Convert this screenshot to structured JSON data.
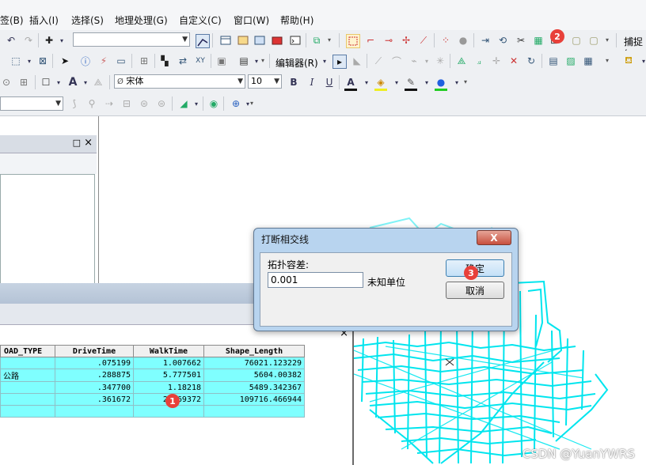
{
  "menu": {
    "items": [
      "签(B)",
      "插入(I)",
      "选择(S)",
      "地理处理(G)",
      "自定义(C)",
      "窗口(W)",
      "帮助(H)"
    ]
  },
  "toolbar1": {
    "snap_label": "捕捉("
  },
  "toolbar2": {
    "editor_label": "编辑器(R)"
  },
  "toolbar3": {
    "font_name": "宋体",
    "font_size": "10",
    "bold": "B",
    "italic": "I",
    "underline": "U"
  },
  "toc": {
    "close_glyph": "×",
    "restore_glyph": "□"
  },
  "attribute_table": {
    "columns": [
      "OAD_TYPE",
      "DriveTime",
      "WalkTime",
      "Shape_Length"
    ],
    "rows": [
      [
        "",
        ".075199",
        "1.007662",
        "76021.123229"
      ],
      [
        "公路",
        ".288875",
        "5.777501",
        "5604.00382"
      ],
      [
        "",
        ".347700",
        "1.18218",
        "5489.342367"
      ],
      [
        "",
        ".361672",
        "2.169372",
        "109716.466944"
      ],
      [
        "",
        "",
        "",
        ""
      ]
    ],
    "close_glyph": "×"
  },
  "dialog": {
    "title": "打断相交线",
    "close_glyph": "X",
    "tolerance_label": "拓扑容差:",
    "tolerance_value": "0.001",
    "unit_label": "未知单位",
    "ok_label": "确定",
    "cancel_label": "取消"
  },
  "badges": {
    "b1": "1",
    "b2": "2",
    "b3": "3"
  },
  "watermark": "CSDN @YuanYWRS",
  "colors": {
    "road": "#00e5ee",
    "badge": "#e8403a",
    "table_fill": "#7fffff"
  }
}
